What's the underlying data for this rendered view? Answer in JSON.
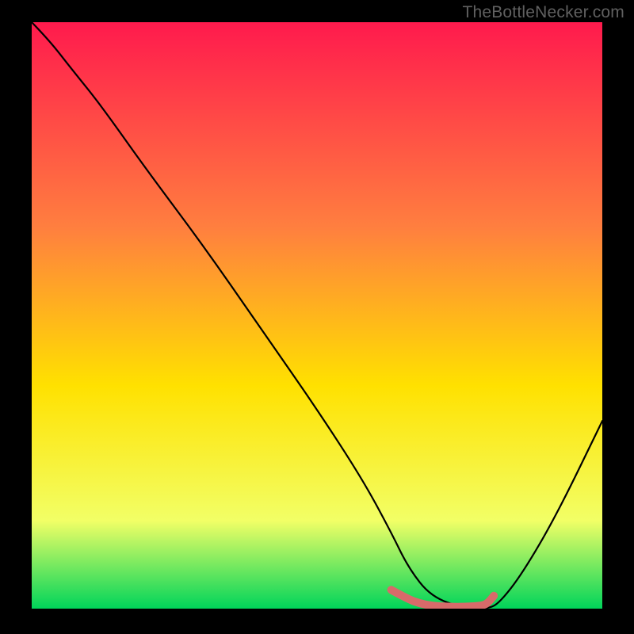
{
  "watermark": "TheBottleNecker.com",
  "chart_data": {
    "type": "line",
    "title": "",
    "xlabel": "",
    "ylabel": "",
    "xlim": [
      0,
      100
    ],
    "ylim": [
      0,
      100
    ],
    "gradient": {
      "top": "#ff1a4d",
      "middle_upper": "#ff7f3f",
      "middle": "#ffe100",
      "lower": "#f2ff66",
      "bottom": "#00d45a"
    },
    "series": [
      {
        "name": "curve",
        "color": "#000000",
        "x": [
          0,
          3,
          7,
          12,
          20,
          30,
          40,
          50,
          58,
          63,
          66,
          70,
          76,
          80,
          82,
          86,
          92,
          100
        ],
        "y": [
          100,
          97,
          92,
          86,
          75,
          62,
          48,
          34,
          22,
          13,
          7,
          2,
          0,
          0,
          1,
          6,
          16,
          32
        ]
      }
    ],
    "highlight": {
      "color": "#d86a6a",
      "x": [
        63,
        66,
        68,
        70,
        73,
        76,
        79,
        80,
        81
      ],
      "y": [
        3.2,
        1.6,
        0.9,
        0.5,
        0.3,
        0.3,
        0.5,
        1.0,
        2.2
      ]
    }
  }
}
